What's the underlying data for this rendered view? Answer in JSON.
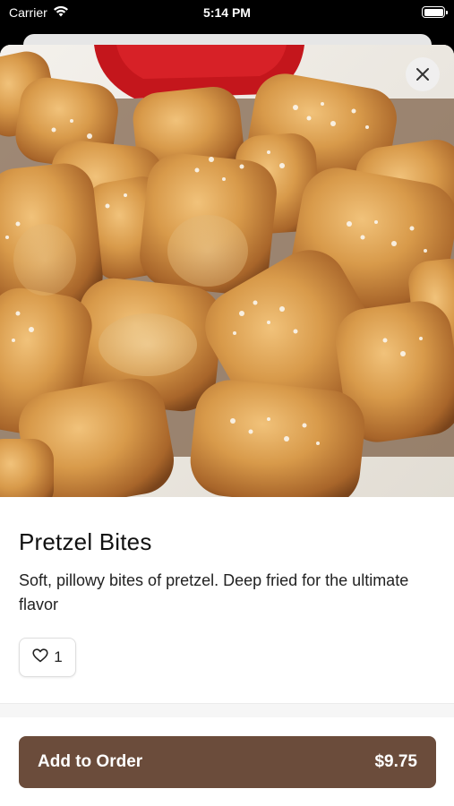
{
  "status_bar": {
    "carrier": "Carrier",
    "time": "5:14 PM"
  },
  "item": {
    "title": "Pretzel Bites",
    "description": "Soft, pillowy bites of pretzel. Deep fried for the ultimate flavor",
    "like_count": "1",
    "image_subject": "pretzel-bites-photo"
  },
  "order_button": {
    "label": "Add to Order",
    "price": "$9.75"
  },
  "colors": {
    "accent": "#6b4c3b",
    "background": "#ffffff"
  },
  "icons": [
    "wifi-icon",
    "battery-icon",
    "close-icon",
    "heart-icon"
  ]
}
